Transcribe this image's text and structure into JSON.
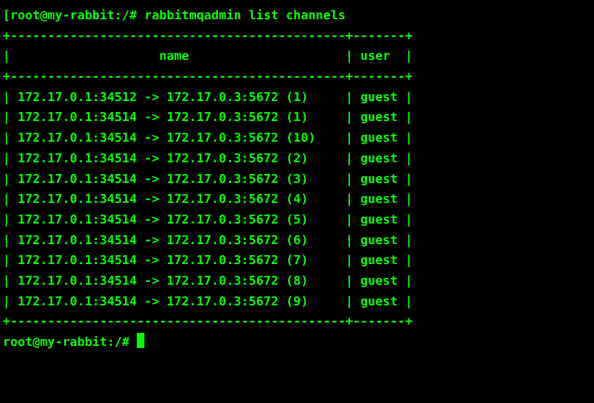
{
  "prompt_prefix": "[",
  "prompt": "root@my-rabbit:/#",
  "command": "rabbitmqadmin list channels",
  "border_top": "+---------------------------------------------+-------+",
  "header_line": "|                    name                     | user  |",
  "border_mid": "+---------------------------------------------+-------+",
  "rows": [
    "| 172.17.0.1:34512 -> 172.17.0.3:5672 (1)     | guest |",
    "| 172.17.0.1:34514 -> 172.17.0.3:5672 (1)     | guest |",
    "| 172.17.0.1:34514 -> 172.17.0.3:5672 (10)    | guest |",
    "| 172.17.0.1:34514 -> 172.17.0.3:5672 (2)     | guest |",
    "| 172.17.0.1:34514 -> 172.17.0.3:5672 (3)     | guest |",
    "| 172.17.0.1:34514 -> 172.17.0.3:5672 (4)     | guest |",
    "| 172.17.0.1:34514 -> 172.17.0.3:5672 (5)     | guest |",
    "| 172.17.0.1:34514 -> 172.17.0.3:5672 (6)     | guest |",
    "| 172.17.0.1:34514 -> 172.17.0.3:5672 (7)     | guest |",
    "| 172.17.0.1:34514 -> 172.17.0.3:5672 (8)     | guest |",
    "| 172.17.0.1:34514 -> 172.17.0.3:5672 (9)     | guest |"
  ],
  "border_bottom": "+---------------------------------------------+-------+",
  "prompt2": "root@my-rabbit:/#"
}
